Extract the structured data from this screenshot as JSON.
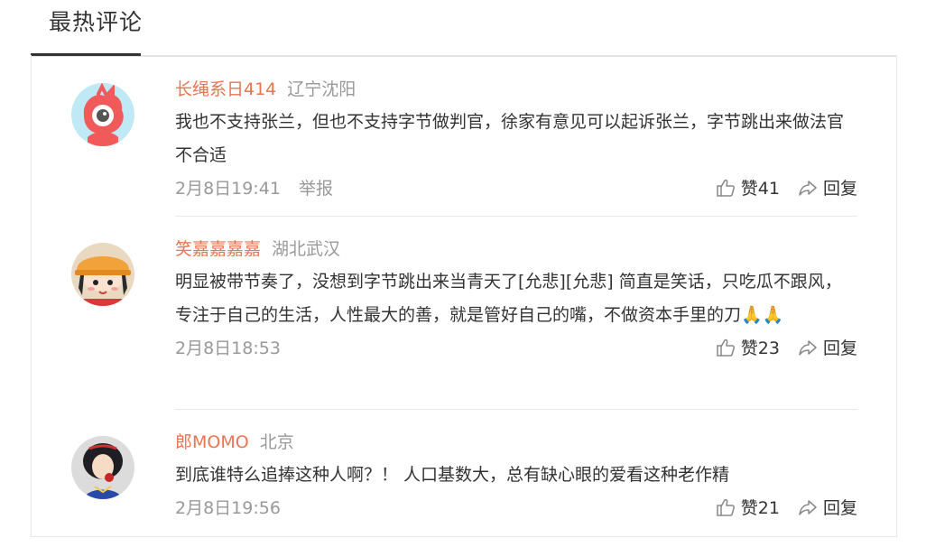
{
  "tab": {
    "label": "最热评论"
  },
  "comments": [
    {
      "username": "长绳系日414",
      "location": "辽宁沈阳",
      "text": "我也不支持张兰，但也不支持字节做判官，徐家有意见可以起诉张兰，字节跳出来做法官不合适",
      "time": "2月8日19:41",
      "report": "举报",
      "likes": "赞41",
      "reply": "回复"
    },
    {
      "username": "笑嘉嘉嘉嘉",
      "location": "湖北武汉",
      "text": "明显被带节奏了，没想到字节跳出来当青天了[允悲][允悲] 简直是笑话，只吃瓜不跟风，专注于自己的生活，人性最大的善，就是管好自己的嘴，不做资本手里的刀🙏🙏",
      "time": "2月8日18:53",
      "likes": "赞23",
      "reply": "回复"
    },
    {
      "username": "郎MOMO",
      "location": "北京",
      "text": "到底谁特么追捧这种人啊？！ 人口基数大，总有缺心眼的爱看这种老作精",
      "time": "2月8日19:56",
      "likes": "赞21",
      "reply": "回复"
    }
  ],
  "colors": {
    "username": "#eb7350",
    "secondary": "#999999",
    "text": "#333333"
  }
}
